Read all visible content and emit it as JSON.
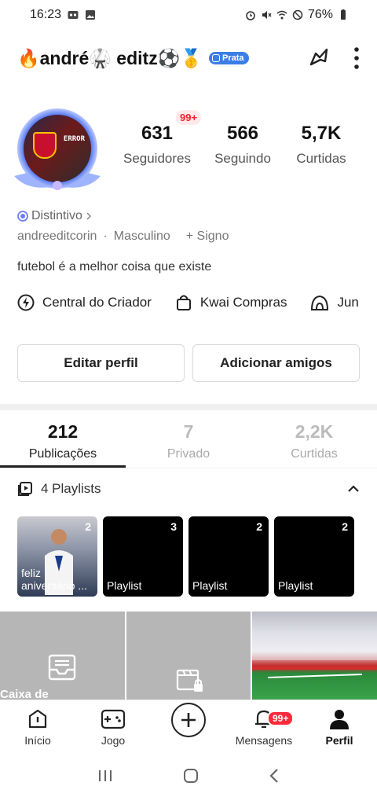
{
  "status_bar": {
    "time": "16:23",
    "battery": "76%"
  },
  "header": {
    "username": "🔥andré🥋 editz⚽🥇",
    "level_badge": "Prata"
  },
  "profile": {
    "avatar_text": "ERROR",
    "notification_badge": "99+",
    "stats": [
      {
        "value": "631",
        "label": "Seguidores"
      },
      {
        "value": "566",
        "label": "Seguindo"
      },
      {
        "value": "5,7K",
        "label": "Curtidas"
      }
    ],
    "distintivo": "Distintivo",
    "handle": "andreeditcorin",
    "separator": "·",
    "gender": "Masculino",
    "sign": "+ Signo",
    "bio": "futebol é a melhor coisa que existe"
  },
  "shortcuts": [
    {
      "icon": "lightning-icon",
      "label": "Central do Criador"
    },
    {
      "icon": "shopping-bag-icon",
      "label": "Kwai Compras"
    },
    {
      "icon": "house-icon",
      "label": "Jun"
    }
  ],
  "buttons": {
    "edit": "Editar perfil",
    "add_friends": "Adicionar amigos"
  },
  "tabs": [
    {
      "value": "212",
      "label": "Publicações",
      "active": true
    },
    {
      "value": "7",
      "label": "Privado",
      "active": false
    },
    {
      "value": "2,2K",
      "label": "Curtidas",
      "active": false
    }
  ],
  "playlists": {
    "header": "4 Playlists",
    "items": [
      {
        "count": "2",
        "title": "feliz aniversário ..."
      },
      {
        "count": "3",
        "title": "Playlist"
      },
      {
        "count": "2",
        "title": "Playlist"
      },
      {
        "count": "2",
        "title": "Playlist"
      }
    ]
  },
  "grid": {
    "cell1_label": "Caixa de"
  },
  "bottom_nav": {
    "items": [
      {
        "label": "Início"
      },
      {
        "label": "Jogo"
      },
      {
        "label": ""
      },
      {
        "label": "Mensagens",
        "badge": "99+"
      },
      {
        "label": "Perfil"
      }
    ]
  },
  "colors": {
    "accent_blue": "#3c7ee6",
    "badge_red": "#ff2a3a",
    "text_dark": "#222222"
  }
}
